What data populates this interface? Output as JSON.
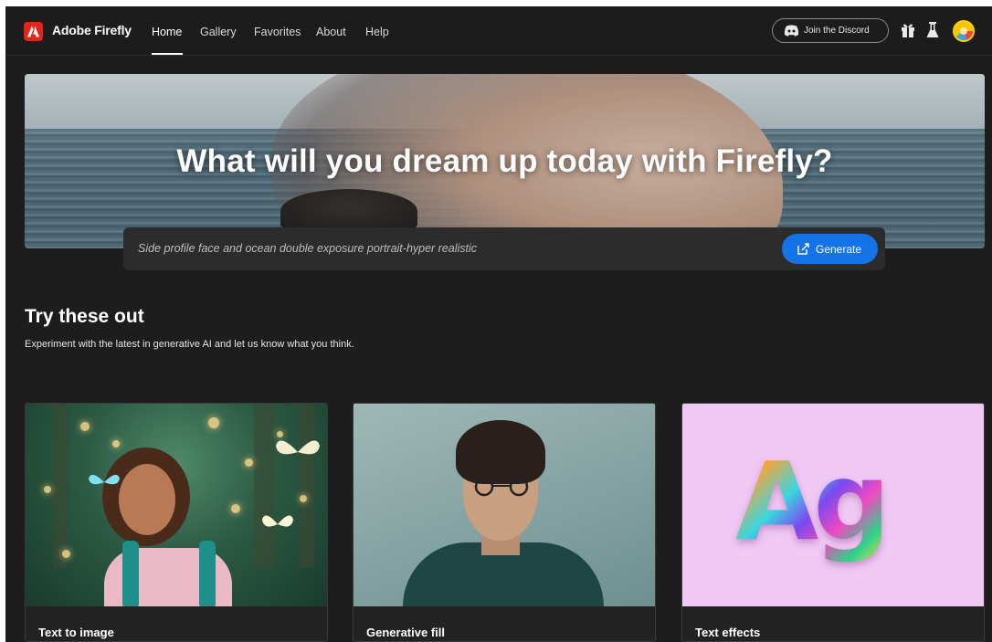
{
  "app": {
    "name": "Adobe Firefly",
    "brand_color": "#e1251b",
    "accent_color": "#1473e6"
  },
  "nav": {
    "items": [
      {
        "label": "Home",
        "active": true
      },
      {
        "label": "Gallery",
        "active": false
      },
      {
        "label": "Favorites",
        "active": false
      },
      {
        "label": "About",
        "active": false
      },
      {
        "label": "Help",
        "active": false
      }
    ],
    "discord_label": "Join the Discord",
    "utility_icons": [
      "discord-icon",
      "gift-icon",
      "flask-icon",
      "avatar"
    ]
  },
  "hero": {
    "title": "What will you dream up today with Firefly?",
    "prompt_value": "Side profile face and ocean double exposure portrait-hyper realistic",
    "generate_label": "Generate"
  },
  "section": {
    "title": "Try these out",
    "subtitle": "Experiment with the latest in generative AI and let us know what you think."
  },
  "cards": [
    {
      "label": "Text to image"
    },
    {
      "label": "Generative fill"
    },
    {
      "label": "Text effects",
      "art_text": "Ag"
    }
  ]
}
